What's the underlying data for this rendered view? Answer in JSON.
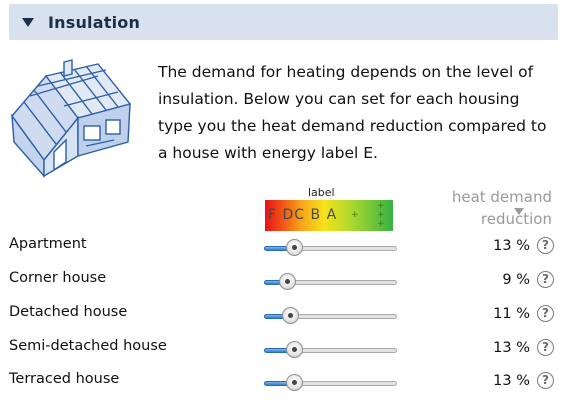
{
  "panel": {
    "title": "Insulation",
    "collapse_icon": "triangle-down-icon",
    "house_icon": "house-wireframe-icon"
  },
  "intro": "The demand for heating depends on the level of insulation. Below you can set for each housing type you the heat demand reduction compared to a house with energy label E.",
  "energy_scale": {
    "caption": "label",
    "letters": "F DC B A",
    "plus_marks": "+"
  },
  "column_header": {
    "line1": "heat demand",
    "line2": "reduction",
    "sort_icon": "sort-down-icon"
  },
  "help_glyph": "?",
  "rows": [
    {
      "name": "Apartment",
      "value_text": "13 %",
      "level": 0.13
    },
    {
      "name": "Corner house",
      "value_text": "9 %",
      "level": 0.09
    },
    {
      "name": "Detached house",
      "value_text": "11 %",
      "level": 0.11
    },
    {
      "name": "Semi-detached house",
      "value_text": "13 %",
      "level": 0.13
    },
    {
      "name": "Terraced house",
      "value_text": "13 %",
      "level": 0.13
    }
  ],
  "colors": {
    "header_bg": "#d8e1ee",
    "header_text": "#1c2f47",
    "slider_fill": "#2f7fd2",
    "muted_text": "#9a9a9a"
  }
}
